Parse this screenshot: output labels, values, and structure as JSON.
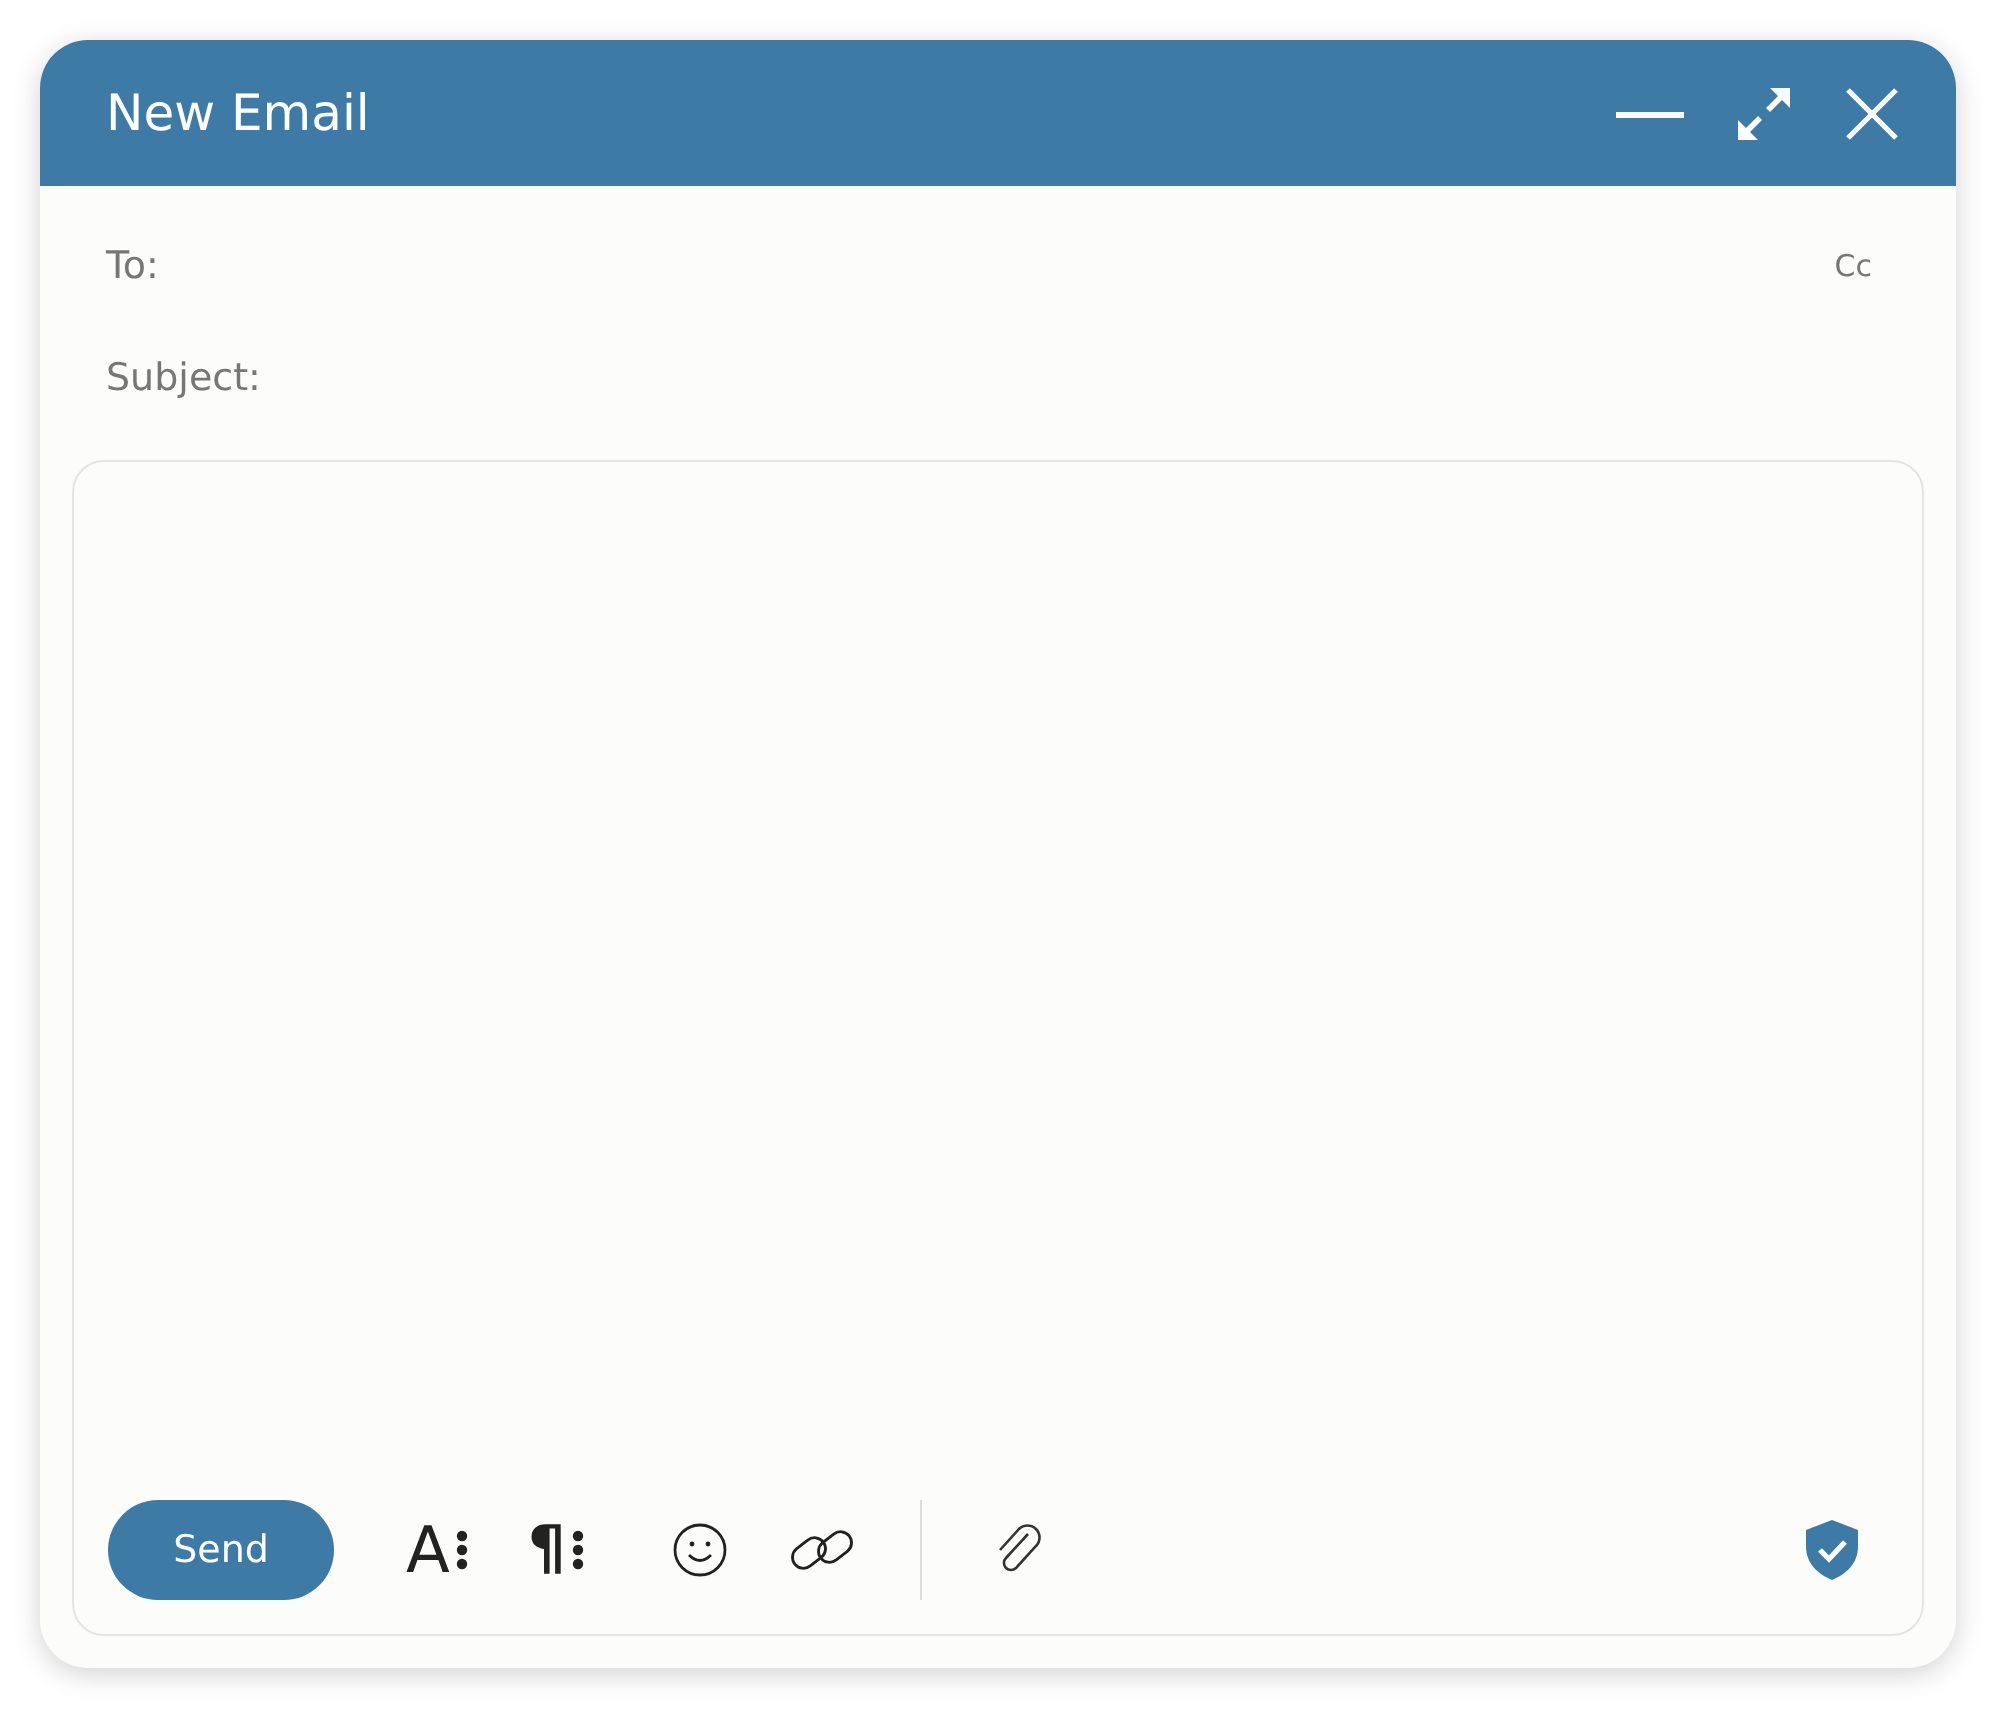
{
  "window": {
    "title": "New Email"
  },
  "fields": [
    {
      "label": "To:",
      "kind": "recipients"
    },
    {
      "label": "Subject:",
      "kind": "subject"
    }
  ],
  "cc_link": "Cc",
  "toolbar": {
    "send_button": "Send",
    "format_buttons": [
      {
        "glyph": "A",
        "kind": "text-format"
      },
      {
        "glyph": "¶",
        "kind": "paragraph-format"
      }
    ]
  }
}
